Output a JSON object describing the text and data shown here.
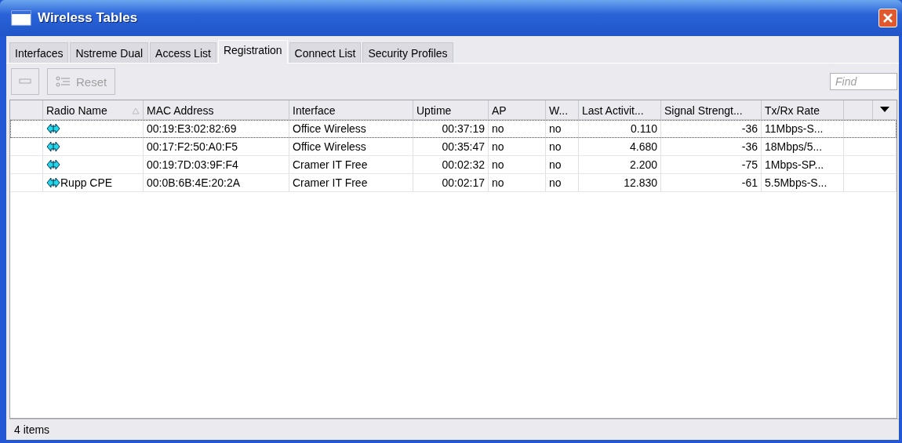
{
  "window": {
    "title": "Wireless Tables"
  },
  "tabs": [
    {
      "label": "Interfaces",
      "selected": false
    },
    {
      "label": "Nstreme Dual",
      "selected": false
    },
    {
      "label": "Access List",
      "selected": false
    },
    {
      "label": "Registration",
      "selected": true
    },
    {
      "label": "Connect List",
      "selected": false
    },
    {
      "label": "Security Profiles",
      "selected": false
    }
  ],
  "toolbar": {
    "reset_button": {
      "label": "Reset",
      "disabled": true
    },
    "search": {
      "placeholder": "Find"
    }
  },
  "table": {
    "columns": [
      {
        "label": "Radio Name",
        "kind": "text",
        "sorted": true
      },
      {
        "label": "MAC Address",
        "kind": "text",
        "sorted": false
      },
      {
        "label": "Interface",
        "kind": "text",
        "sorted": false
      },
      {
        "label": "Uptime",
        "kind": "number",
        "sorted": false
      },
      {
        "label": "AP",
        "kind": "text",
        "sorted": false
      },
      {
        "label": "W...",
        "kind": "text",
        "sorted": false
      },
      {
        "label": "Last Activit...",
        "kind": "number",
        "sorted": false
      },
      {
        "label": "Signal Strengt...",
        "kind": "number",
        "sorted": false
      },
      {
        "label": "Tx/Rx Rate",
        "kind": "text",
        "sorted": false
      }
    ],
    "rows": [
      {
        "selected": true,
        "cells": [
          "",
          "00:19:E3:02:82:69",
          "Office Wireless",
          "00:37:19",
          "no",
          "no",
          "0.110",
          "-36",
          "11Mbps-S..."
        ]
      },
      {
        "selected": false,
        "cells": [
          "",
          "00:17:F2:50:A0:F5",
          "Office Wireless",
          "00:35:47",
          "no",
          "no",
          "4.680",
          "-36",
          "18Mbps/5..."
        ]
      },
      {
        "selected": false,
        "cells": [
          "",
          "00:19:7D:03:9F:F4",
          "Cramer IT Free",
          "00:02:32",
          "no",
          "no",
          "2.200",
          "-75",
          "1Mbps-SP..."
        ]
      },
      {
        "selected": false,
        "cells": [
          "Rupp CPE",
          "00:0B:6B:4E:20:2A",
          "Cramer IT Free",
          "00:02:17",
          "no",
          "no",
          "12.830",
          "-61",
          "5.5Mbps-S..."
        ]
      }
    ]
  },
  "status_bar": {
    "text": "4 items"
  }
}
